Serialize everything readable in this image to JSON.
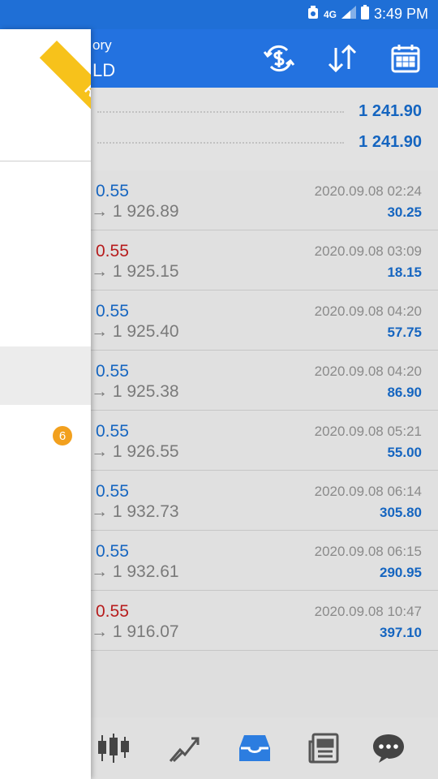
{
  "status_bar": {
    "time": "3:49 PM",
    "network": "4G"
  },
  "header": {
    "title_top": "ory",
    "title_bottom": "LD"
  },
  "summary": {
    "rows": [
      "1 241.90",
      "1 241.90"
    ]
  },
  "trades": [
    {
      "lot": "0.55",
      "side": "buy",
      "price": "→ 1 926.89",
      "time": "2020.09.08 02:24",
      "profit": "30.25"
    },
    {
      "lot": "0.55",
      "side": "sell",
      "price": "→ 1 925.15",
      "time": "2020.09.08 03:09",
      "profit": "18.15"
    },
    {
      "lot": "0.55",
      "side": "buy",
      "price": "→ 1 925.40",
      "time": "2020.09.08 04:20",
      "profit": "57.75"
    },
    {
      "lot": "0.55",
      "side": "buy",
      "price": "→ 1 925.38",
      "time": "2020.09.08 04:20",
      "profit": "86.90"
    },
    {
      "lot": "0.55",
      "side": "buy",
      "price": "→ 1 926.55",
      "time": "2020.09.08 05:21",
      "profit": "55.00"
    },
    {
      "lot": "0.55",
      "side": "buy",
      "price": "→ 1 932.73",
      "time": "2020.09.08 06:14",
      "profit": "305.80"
    },
    {
      "lot": "0.55",
      "side": "buy",
      "price": "→ 1 932.61",
      "time": "2020.09.08 06:15",
      "profit": "290.95"
    },
    {
      "lot": "0.55",
      "side": "sell",
      "price": "→ 1 916.07",
      "time": "2020.09.08 10:47",
      "profit": "397.10"
    }
  ],
  "drawer": {
    "ribbon_label": "Real",
    "badge_count": "6"
  },
  "colors": {
    "header": "#2372e0",
    "buy": "#1565c0",
    "sell": "#b71c1c",
    "ribbon": "#f7c21b",
    "badge": "#f2a01e"
  },
  "icons": {
    "header": [
      "currency-exchange-icon",
      "sort-icon",
      "calendar-icon"
    ],
    "nav": [
      "quotes-icon",
      "chart-icon",
      "trade-icon",
      "news-icon",
      "chat-icon"
    ]
  }
}
